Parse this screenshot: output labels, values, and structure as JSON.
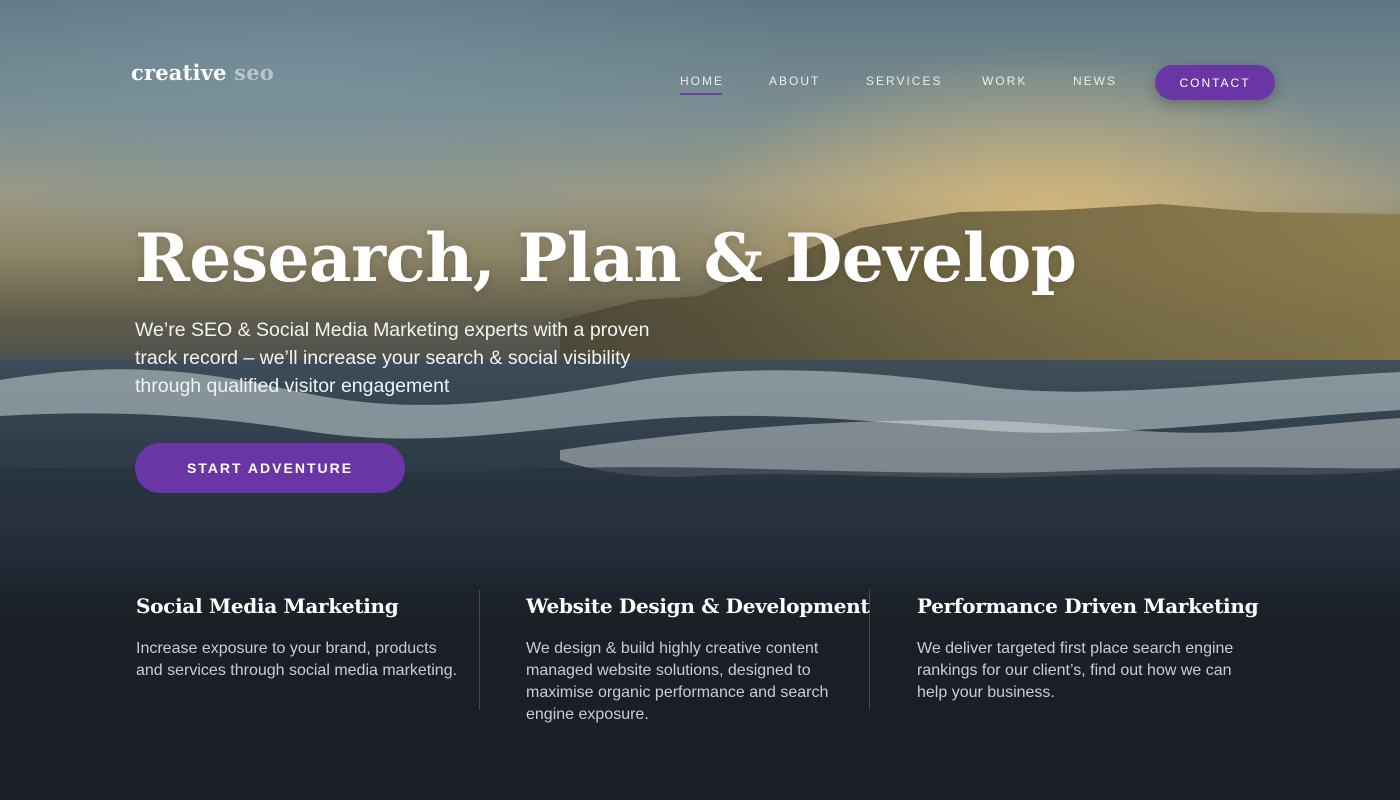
{
  "brand": {
    "logo_part1": "creative",
    "logo_part2": " seo"
  },
  "nav": {
    "items": [
      {
        "label": "HOME",
        "active": true
      },
      {
        "label": "ABOUT",
        "active": false
      },
      {
        "label": "SERVICES",
        "active": false
      },
      {
        "label": "WORK",
        "active": false
      },
      {
        "label": "NEWS",
        "active": false
      }
    ],
    "contact_label": "CONTACT"
  },
  "hero": {
    "title": "Research, Plan & Develop",
    "subtitle": "We’re SEO & Social Media Marketing experts with a proven track record – we’ll increase your search & social visibility through qualified visitor engagement",
    "cta_label": "START ADVENTURE"
  },
  "features": [
    {
      "title": "Social Media Marketing",
      "text": "Increase exposure to your brand, products and services through social media marketing."
    },
    {
      "title": "Website Design & Development",
      "text": "We design & build highly creative content managed website solutions, designed to maximise organic performance and search engine exposure."
    },
    {
      "title": "Performance Driven Marketing",
      "text": "We deliver targeted first place search engine rankings for our client’s, find out how we can help your business."
    }
  ],
  "colors": {
    "accent": "#6a36a6",
    "background_dark": "#1b1e24"
  }
}
